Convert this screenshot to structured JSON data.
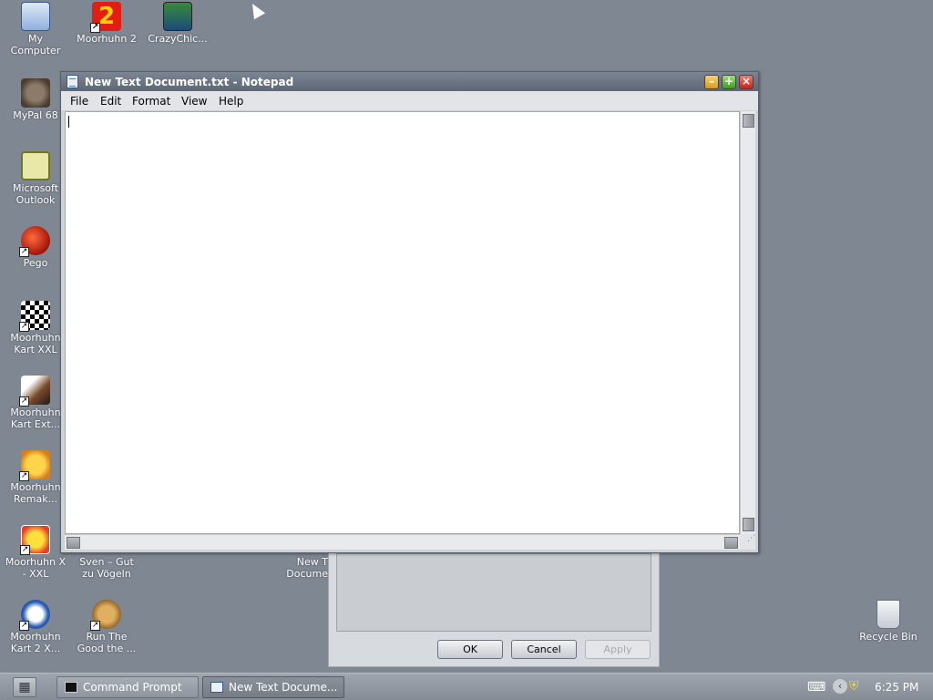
{
  "desktop": {
    "icons": [
      {
        "label": "My\nComputer",
        "icon": "computer-icon",
        "shortcut": false
      },
      {
        "label": "Moorhuhn 2",
        "icon": "moorhuhn2-icon",
        "shortcut": true
      },
      {
        "label": "CrazyChic...",
        "icon": "crazychicken-icon",
        "shortcut": false
      },
      {
        "label": "MyPal 68",
        "icon": "raccoon-icon",
        "shortcut": false
      },
      {
        "label": "Microsoft\nOutlook",
        "icon": "outlook-icon",
        "shortcut": false
      },
      {
        "label": "Pego",
        "icon": "pego-icon",
        "shortcut": true
      },
      {
        "label": "Moorhuhn\nKart XXL",
        "icon": "kart-xxl-icon",
        "shortcut": true
      },
      {
        "label": "Moorhuhn\nKart Ext...",
        "icon": "kart-ext-icon",
        "shortcut": true
      },
      {
        "label": "Moorhuhn\nRemak...",
        "icon": "remake-icon",
        "shortcut": true
      },
      {
        "label": "Moorhuhn X\n- XXL",
        "icon": "moorhuhn-x-icon",
        "shortcut": true
      },
      {
        "label": "Sven – Gut\nzu Vögeln",
        "icon": "sven-icon",
        "shortcut": false
      },
      {
        "label": "New T\nDocume",
        "icon": "text-doc-icon",
        "shortcut": false
      },
      {
        "label": "Moorhuhn\nKart 2 X...",
        "icon": "kart2-icon",
        "shortcut": true
      },
      {
        "label": "Run The\nGood the ...",
        "icon": "run-good-icon",
        "shortcut": true
      },
      {
        "label": "Recycle Bin",
        "icon": "recycle-bin-icon",
        "shortcut": false
      }
    ]
  },
  "notepad": {
    "title": "New Text Document.txt - Notepad",
    "menu": [
      "File",
      "Edit",
      "Format",
      "View",
      "Help"
    ],
    "content": ""
  },
  "dialog": {
    "ok": "OK",
    "cancel": "Cancel",
    "apply": "Apply"
  },
  "taskbar": {
    "tasks": [
      {
        "label": "Command Prompt",
        "active": false
      },
      {
        "label": "New Text Docume...",
        "active": true
      }
    ],
    "clock": "6:25 PM"
  },
  "colors": {
    "desktop": "#7f8792",
    "close": "#c2261a",
    "minimize": "#d99a1c",
    "maximize": "#3f9a22"
  }
}
